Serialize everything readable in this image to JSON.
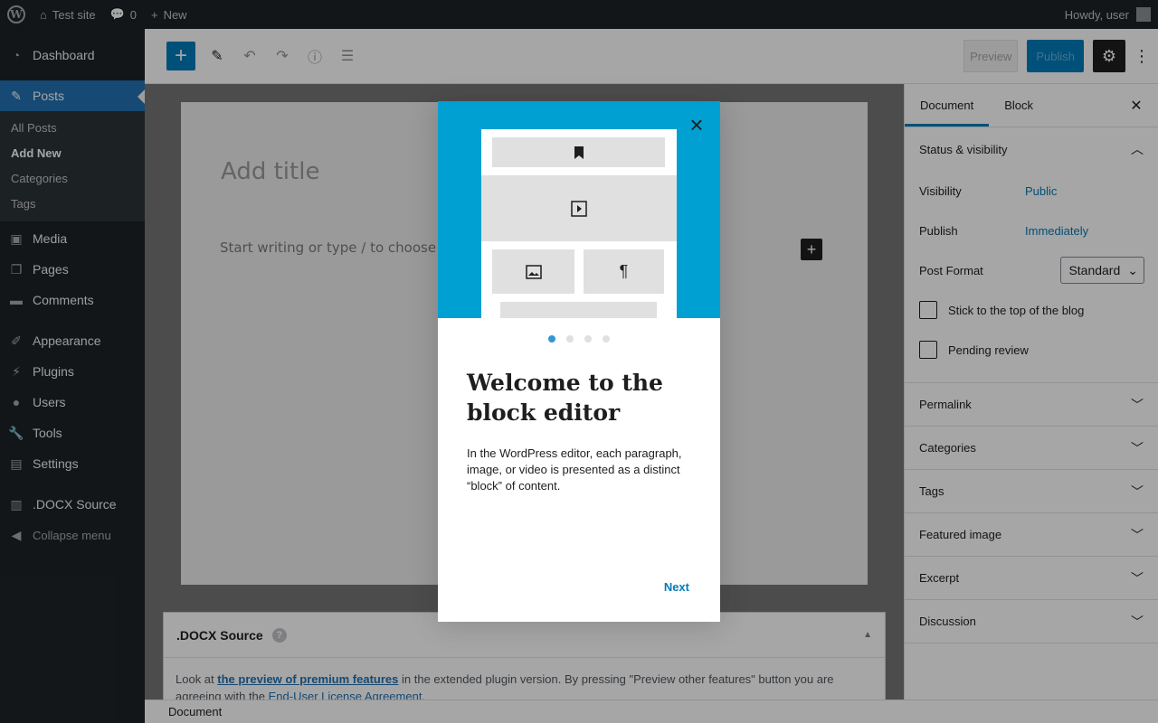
{
  "adminbar": {
    "site_name": "Test site",
    "comments_count": "0",
    "new_label": "New",
    "howdy": "Howdy, user"
  },
  "sidebar": {
    "items": [
      {
        "label": "Dashboard",
        "icon": "dashboard-icon"
      },
      {
        "label": "Posts",
        "icon": "pin-icon"
      },
      {
        "label": "Media",
        "icon": "media-icon"
      },
      {
        "label": "Pages",
        "icon": "pages-icon"
      },
      {
        "label": "Comments",
        "icon": "comment-icon"
      },
      {
        "label": "Appearance",
        "icon": "brush-icon"
      },
      {
        "label": "Plugins",
        "icon": "plug-icon"
      },
      {
        "label": "Users",
        "icon": "user-icon"
      },
      {
        "label": "Tools",
        "icon": "wrench-icon"
      },
      {
        "label": "Settings",
        "icon": "settings-icon"
      },
      {
        "label": ".DOCX Source",
        "icon": "building-icon"
      },
      {
        "label": "Collapse menu",
        "icon": "collapse-icon"
      }
    ],
    "submenu": [
      "All Posts",
      "Add New",
      "Categories",
      "Tags"
    ]
  },
  "header": {
    "preview_label": "Preview",
    "publish_label": "Publish"
  },
  "editor": {
    "title_placeholder": "Add title",
    "body_placeholder": "Start writing or type / to choose a"
  },
  "metabox": {
    "title": ".DOCX Source",
    "text_before": "Look at ",
    "link_premium": "the preview of premium features",
    "text_middle": " in the extended plugin version. By pressing \"Preview other features\" button you are agreeing with the ",
    "link_eula": "End-User License Agreement",
    "text_end": "."
  },
  "footer": {
    "breadcrumb": "Document"
  },
  "settings": {
    "tab_document": "Document",
    "tab_block": "Block",
    "status_title": "Status & visibility",
    "visibility_label": "Visibility",
    "visibility_value": "Public",
    "publish_label": "Publish",
    "publish_value": "Immediately",
    "post_format_label": "Post Format",
    "post_format_value": "Standard",
    "stick_label": "Stick to the top of the blog",
    "pending_label": "Pending review",
    "panels": [
      "Permalink",
      "Categories",
      "Tags",
      "Featured image",
      "Excerpt",
      "Discussion"
    ]
  },
  "guide": {
    "heading": "Welcome to the block editor",
    "text": "In the WordPress editor, each paragraph, image, or video is presented as a distinct “block” of content.",
    "next_label": "Next",
    "page_count": 4,
    "current_page": 1
  },
  "colors": {
    "accent": "#007cba",
    "admin_dark": "#1d2327",
    "guide_hero": "#00a0d2"
  }
}
